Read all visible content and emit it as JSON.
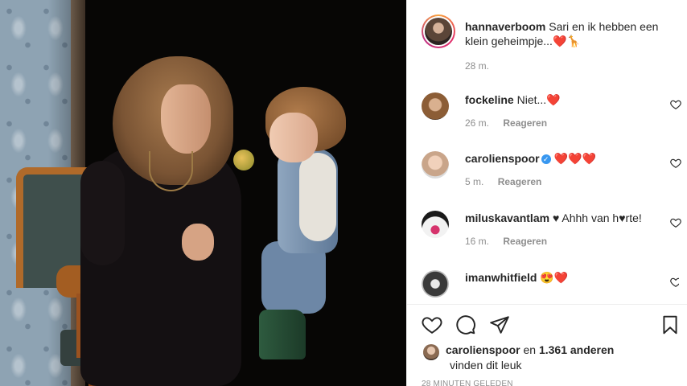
{
  "post": {
    "author": "hannaverboom",
    "caption_text": "Sari en ik hebben een klein geheimpje...",
    "caption_emoji": "❤️🦒",
    "time": "28 m."
  },
  "comments": [
    {
      "user": "fockeline",
      "text": "Niet...",
      "emoji": "❤️",
      "time": "26 m.",
      "reply": "Reageren",
      "verified": false
    },
    {
      "user": "carolienspoor",
      "text": "",
      "emoji": "❤️❤️❤️",
      "time": "5 m.",
      "reply": "Reageren",
      "verified": true
    },
    {
      "user": "miluskavantlam",
      "text": "♥ Ahhh van h♥rte!",
      "emoji": "",
      "time": "16 m.",
      "reply": "Reageren",
      "verified": false
    },
    {
      "user": "imanwhitfield",
      "text": "",
      "emoji": "😍❤️",
      "time": "",
      "reply": "",
      "verified": false
    }
  ],
  "likes": {
    "user": "carolienspoor",
    "connector": "en",
    "count_text": "1.361 anderen",
    "suffix": "vinden dit leuk"
  },
  "footer_time": "28 MINUTEN GELEDEN",
  "icons": {
    "like": "heart-icon",
    "comment": "comment-icon",
    "share": "share-icon",
    "save": "bookmark-icon",
    "verified": "verified-badge-icon"
  },
  "colors": {
    "heart": "#ed4956",
    "verified": "#3897f0",
    "meta_text": "#8e8e8e"
  }
}
